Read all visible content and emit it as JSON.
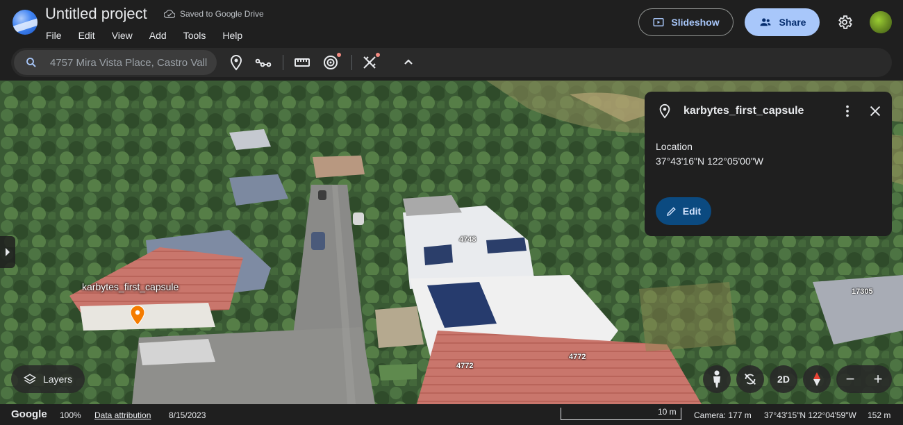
{
  "header": {
    "title": "Untitled project",
    "saved_status": "Saved to Google Drive",
    "menu": [
      "File",
      "Edit",
      "View",
      "Add",
      "Tools",
      "Help"
    ],
    "slideshow_label": "Slideshow",
    "share_label": "Share"
  },
  "toolbar": {
    "search_value": "4757 Mira Vista Place, Castro Vall",
    "icons": [
      "placemark-icon",
      "path-icon",
      "ruler-icon",
      "voyager-icon",
      "measure-tool-icon",
      "collapse-icon"
    ]
  },
  "map": {
    "placemark_label": "karbytes_first_capsule",
    "address_labels": [
      "4748",
      "4772",
      "4772",
      "17305"
    ],
    "layers_label": "Layers",
    "view_mode_label": "2D",
    "zoom_in": "+",
    "zoom_out": "−"
  },
  "info_panel": {
    "title": "karbytes_first_capsule",
    "location_label": "Location",
    "location_value": "37°43'16\"N 122°05'00\"W",
    "edit_label": "Edit"
  },
  "footer": {
    "brand": "Google",
    "zoom_percent": "100%",
    "attribution_label": "Data attribution",
    "imagery_date": "8/15/2023",
    "scale_label": "10 m",
    "camera": "Camera: 177 m",
    "coordinates": "37°43'15\"N 122°04'59\"W",
    "elevation": "152 m"
  },
  "colors": {
    "accent": "#a8c7fa",
    "share_text": "#062e6f",
    "edit_button": "#0b4a80",
    "pin": "#f57c00",
    "background": "#1f1f1f"
  }
}
